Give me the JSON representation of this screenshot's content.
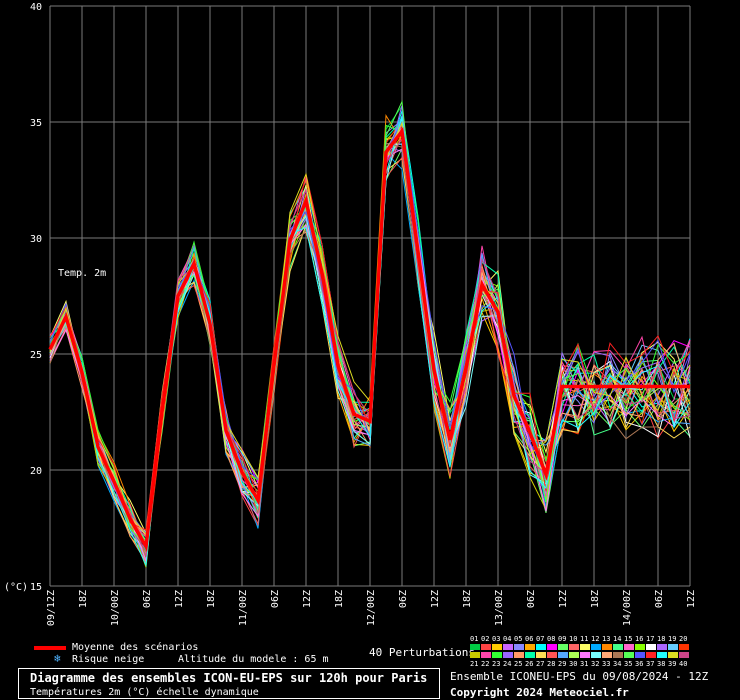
{
  "chart_data": {
    "type": "line",
    "title": "Diagramme des ensembles ICON-EU-EPS sur 120h pour Paris",
    "subtitle": "Températures 2m (°C) échelle dynamique",
    "ylabel": "(°C)",
    "series_label": "Temp. 2m",
    "ylim": [
      15,
      40
    ],
    "y_ticks": [
      "40",
      "35",
      "30",
      "25",
      "20",
      "15"
    ],
    "x_ticks": [
      "09/12Z",
      "18Z",
      "10/00Z",
      "06Z",
      "12Z",
      "18Z",
      "11/00Z",
      "06Z",
      "12Z",
      "18Z",
      "12/00Z",
      "06Z",
      "12Z",
      "18Z",
      "13/00Z",
      "06Z",
      "12Z",
      "18Z",
      "14/00Z",
      "06Z",
      "12Z"
    ],
    "x_hours": [
      0,
      3,
      6,
      9,
      12,
      15,
      18,
      21,
      24,
      27,
      30,
      33,
      36,
      39,
      42,
      45,
      48,
      51,
      54,
      57,
      60,
      63,
      66,
      69,
      72,
      75,
      78,
      81,
      84,
      87,
      90,
      93,
      96,
      99,
      102,
      105,
      108,
      111,
      114,
      117,
      120
    ],
    "grid": true,
    "mean_series": {
      "name": "Moyenne des scénarios",
      "color": "#ff0000",
      "values": [
        25.2,
        26.6,
        24.2,
        21.0,
        19.5,
        17.9,
        16.7,
        22.5,
        27.5,
        28.9,
        26.3,
        21.7,
        19.9,
        18.7,
        24.5,
        29.9,
        31.6,
        28.5,
        24.5,
        22.4,
        22.1,
        33.7,
        34.6,
        29.4,
        24.3,
        21.3,
        24.4,
        28.0,
        26.8,
        23.2,
        21.6,
        19.8,
        23.6,
        23.6,
        23.6,
        23.6,
        23.6,
        23.6,
        23.6,
        23.6,
        23.6
      ]
    },
    "ensemble_count": 40
  },
  "legend": {
    "mean_label": "Moyenne des scénarios",
    "snow_label": "Risque neige",
    "altitude_label": "Altitude du modele : 65 m",
    "perturbations_label": "40 Perturbations",
    "pert_numbers_row1": [
      "01",
      "02",
      "03",
      "04",
      "05",
      "06",
      "07",
      "08",
      "09",
      "10",
      "11",
      "12",
      "13",
      "14",
      "15",
      "16",
      "17",
      "18",
      "19",
      "20"
    ],
    "pert_numbers_row2": [
      "21",
      "22",
      "23",
      "24",
      "25",
      "26",
      "27",
      "28",
      "29",
      "30",
      "31",
      "32",
      "33",
      "34",
      "35",
      "36",
      "37",
      "38",
      "39",
      "40"
    ],
    "pert_colors_row1": [
      "#00cc44",
      "#ff4444",
      "#ffcc00",
      "#cc66ff",
      "#8888ff",
      "#ffaa00",
      "#00ffff",
      "#ff00ff",
      "#66ff66",
      "#ff6666",
      "#ffff66",
      "#00aaff",
      "#ff8800",
      "#44ff88",
      "#ff66cc",
      "#88ff00",
      "#ffffff",
      "#aa66ff",
      "#66ccff",
      "#ff3300"
    ],
    "pert_colors_row2": [
      "#cccc00",
      "#ff44aa",
      "#33ff33",
      "#9966ff",
      "#ff9966",
      "#00ffaa",
      "#ffdd55",
      "#ff5555",
      "#55aaff",
      "#aaff55",
      "#ff77ff",
      "#77ffff",
      "#ffaa77",
      "#aa7755",
      "#55ff55",
      "#5555ff",
      "#ff2222",
      "#22ffff",
      "#dddd22",
      "#cc4488"
    ]
  },
  "footer": {
    "title": "Diagramme des ensembles ICON-EU-EPS sur 120h pour Paris",
    "subtitle": "Températures 2m (°C) échelle dynamique",
    "source_line": "Ensemble ICONEU-EPS du 09/08/2024 - 12Z",
    "copyright": "Copyright 2024 Meteociel.fr"
  }
}
